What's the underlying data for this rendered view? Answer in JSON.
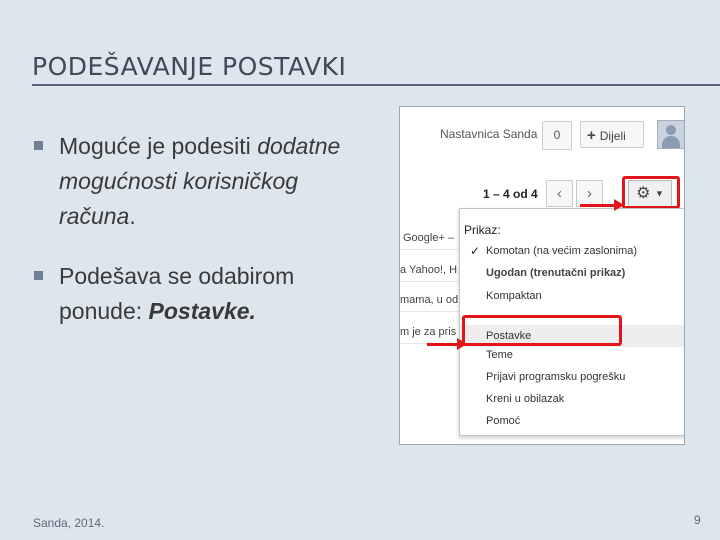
{
  "slide": {
    "title": "PODEŠAVANJE POSTAVKI",
    "bullet1": {
      "plain": "Moguće je podesiti ",
      "italic": "dodatne mogućnosti korisničkog računa",
      "end": "."
    },
    "bullet2": {
      "plain": "Podešava se odabirom ponude: ",
      "bold_italic": "Postavke."
    },
    "footer_left": "Sanda, 2014.",
    "page_number": "9"
  },
  "screenshot": {
    "account_name": "Nastavnica Sanda",
    "notification_count": "0",
    "share_label": "Dijeli",
    "pager_text": "1 – 4 od 4",
    "mail_rows": [
      "Google+ –",
      "a Yahoo!, H",
      "mama, u od",
      "m je za pris"
    ],
    "menu": {
      "header": "Prikaz:",
      "items": [
        "Komotan (na većim zaslonima)",
        "Ugodan (trenutačni prikaz)",
        "Kompaktan",
        "Postavke",
        "Teme",
        "Prijavi programsku pogrešku",
        "Kreni u obilazak",
        "Pomoć"
      ]
    },
    "icons": {
      "share": "plus-icon",
      "gear": "gear-icon",
      "prev": "chevron-left-icon",
      "next": "chevron-right-icon",
      "check": "check-icon",
      "avatar": "avatar-icon"
    },
    "highlight_color": "#e3141a"
  }
}
